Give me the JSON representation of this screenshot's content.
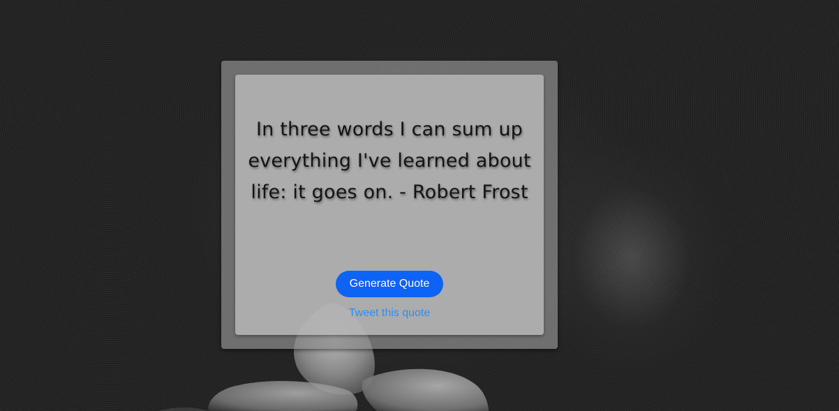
{
  "page": {
    "background_color": "#262626"
  },
  "quote_card": {
    "quote_text": "In three words I can sum up everything I've learned about life: it goes on. - Robert Frost",
    "generate_button_label": "Generate Quote",
    "tweet_link_label": "Tweet this quote"
  },
  "colors": {
    "button": "#0d63f5",
    "link": "#2b8ff0"
  }
}
